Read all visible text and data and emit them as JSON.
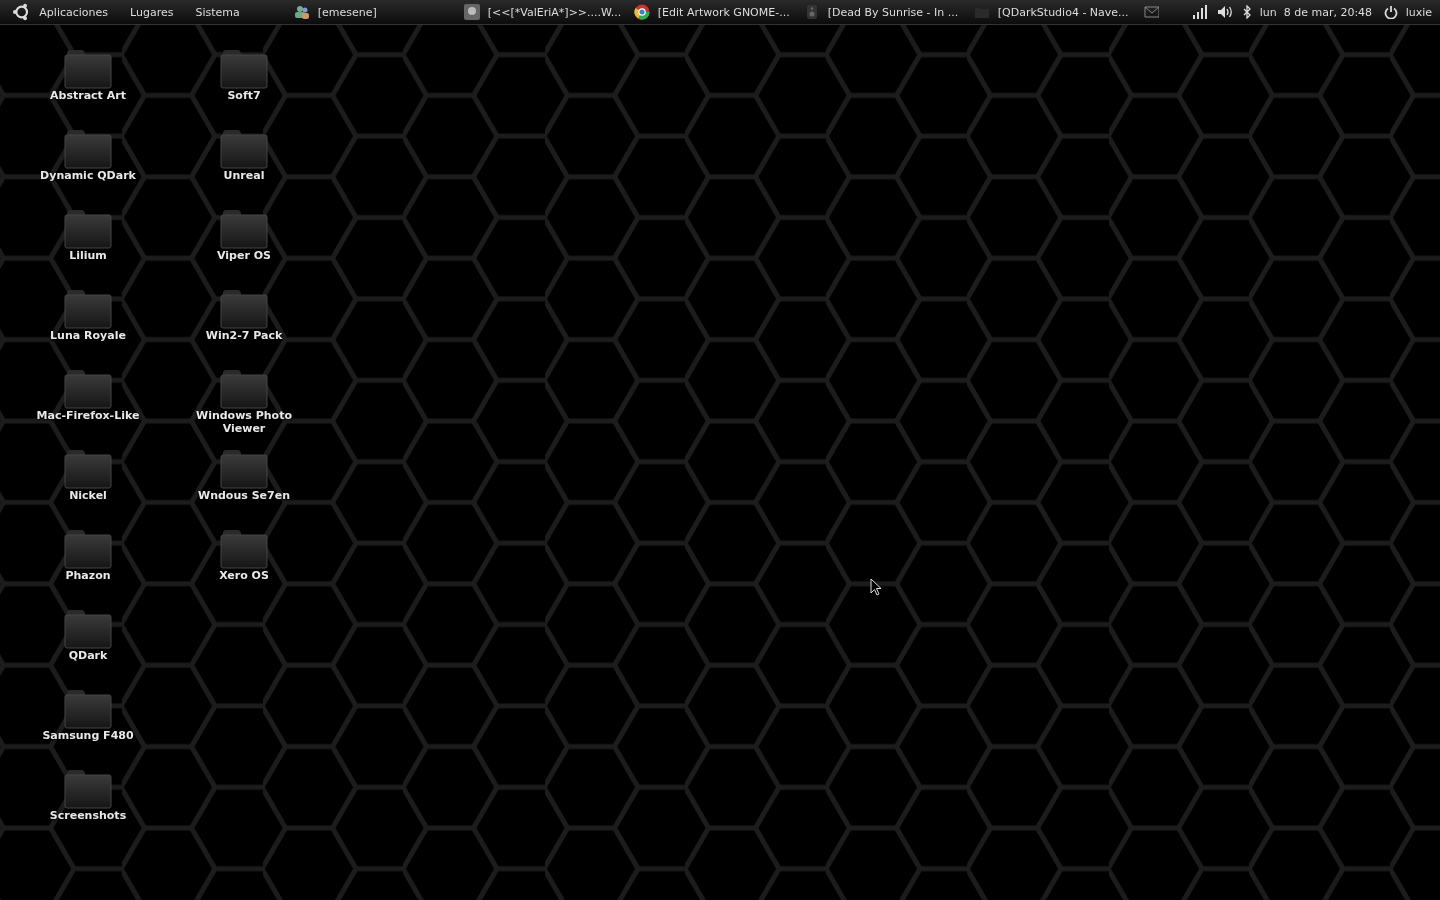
{
  "panel": {
    "menus": [
      "Aplicaciones",
      "Lugares",
      "Sistema"
    ],
    "tasks": [
      {
        "kind": "chat",
        "label": "[emesene]"
      },
      {
        "kind": "avatar",
        "label": "[<<[*ValEriA*]>>....W..."
      },
      {
        "kind": "browser",
        "label": "[Edit Artwork GNOME-..."
      },
      {
        "kind": "speaker",
        "label": "[Dead By Sunrise - In ..."
      },
      {
        "kind": "folder",
        "label": "[QDarkStudio4 - Nave..."
      }
    ],
    "clock": "lun  8 de mar, 20:48",
    "user": "luxie"
  },
  "desktop": {
    "columns": [
      [
        "Abstract Art",
        "Dynamic QDark",
        "Lilium",
        "Luna Royale",
        "Mac-Firefox-Like",
        "Nickel",
        "Phazon",
        "QDark",
        "Samsung F480",
        "Screenshots"
      ],
      [
        "Soft7",
        "Unreal",
        "Viper OS",
        "Win2-7 Pack",
        "Windows Photo Viewer",
        "Wndous Se7en",
        "Xero OS"
      ]
    ]
  }
}
